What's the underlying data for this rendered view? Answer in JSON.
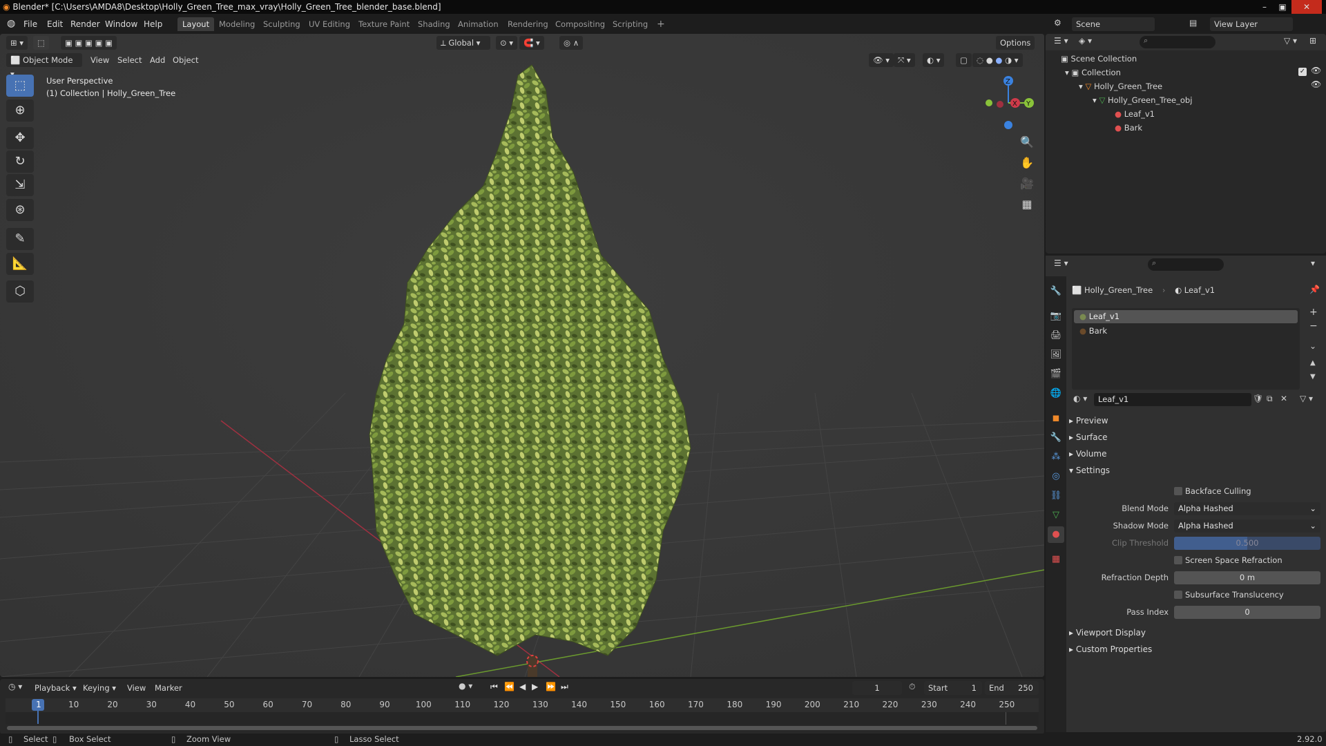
{
  "titlebar": {
    "title": "Blender* [C:\\Users\\AMDA8\\Desktop\\Holly_Green_Tree_max_vray\\Holly_Green_Tree_blender_base.blend]",
    "minimize": "–",
    "maximize": "▣",
    "close": "✕"
  },
  "menubar": {
    "items": [
      "File",
      "Edit",
      "Render",
      "Window",
      "Help"
    ],
    "workspaces": [
      "Layout",
      "Modeling",
      "Sculpting",
      "UV Editing",
      "Texture Paint",
      "Shading",
      "Animation",
      "Rendering",
      "Compositing",
      "Scripting"
    ],
    "add_workspace": "+",
    "scene_label": "Scene",
    "view_layer_label": "View Layer"
  },
  "viewport": {
    "mode": "Object Mode",
    "menu": [
      "View",
      "Select",
      "Add",
      "Object"
    ],
    "transform_orientation": "Global",
    "options": "Options",
    "overlay_line1": "User Perspective",
    "overlay_line2": "(1) Collection | Holly_Green_Tree",
    "gizmo": {
      "x": "X",
      "y": "Y",
      "z": "Z"
    }
  },
  "outliner": {
    "rows": [
      {
        "label": "Scene Collection"
      },
      {
        "label": "Collection"
      },
      {
        "label": "Holly_Green_Tree"
      },
      {
        "label": "Holly_Green_Tree_obj"
      },
      {
        "label": "Leaf_v1"
      },
      {
        "label": "Bark"
      }
    ]
  },
  "properties": {
    "breadcrumb_object": "Holly_Green_Tree",
    "breadcrumb_material": "Leaf_v1",
    "material_slots": [
      "Leaf_v1",
      "Bark"
    ],
    "material_name": "Leaf_v1",
    "panels": {
      "preview": "Preview",
      "surface": "Surface",
      "volume": "Volume",
      "settings": "Settings",
      "viewport_display": "Viewport Display",
      "custom_properties": "Custom Properties"
    },
    "settings": {
      "backface_culling": "Backface Culling",
      "blend_mode_label": "Blend Mode",
      "blend_mode_value": "Alpha Hashed",
      "shadow_mode_label": "Shadow Mode",
      "shadow_mode_value": "Alpha Hashed",
      "clip_threshold_label": "Clip Threshold",
      "clip_threshold_value": "0.500",
      "screen_space_refraction": "Screen Space Refraction",
      "refraction_depth_label": "Refraction Depth",
      "refraction_depth_value": "0 m",
      "subsurface_translucency": "Subsurface Translucency",
      "pass_index_label": "Pass Index",
      "pass_index_value": "0"
    }
  },
  "timeline": {
    "menus": [
      "Playback",
      "Keying",
      "View",
      "Marker"
    ],
    "current_frame": "1",
    "start_label": "Start",
    "start_value": "1",
    "end_label": "End",
    "end_value": "250",
    "frame_ticks": [
      "1",
      "10",
      "20",
      "30",
      "40",
      "50",
      "60",
      "70",
      "80",
      "90",
      "100",
      "110",
      "120",
      "130",
      "140",
      "150",
      "160",
      "170",
      "180",
      "190",
      "200",
      "210",
      "220",
      "230",
      "240",
      "250"
    ]
  },
  "statusbar": {
    "select": "Select",
    "box_select": "Box Select",
    "zoom_view": "Zoom View",
    "lasso_select": "Lasso Select",
    "version": "2.92.0"
  },
  "colors": {
    "accent": "#4772b3",
    "axis_x": "#d03a4a",
    "axis_y": "#8ac33a",
    "axis_z": "#3a82e0",
    "foliage_dark": "#4a5e28",
    "foliage_light": "#a3b855"
  }
}
